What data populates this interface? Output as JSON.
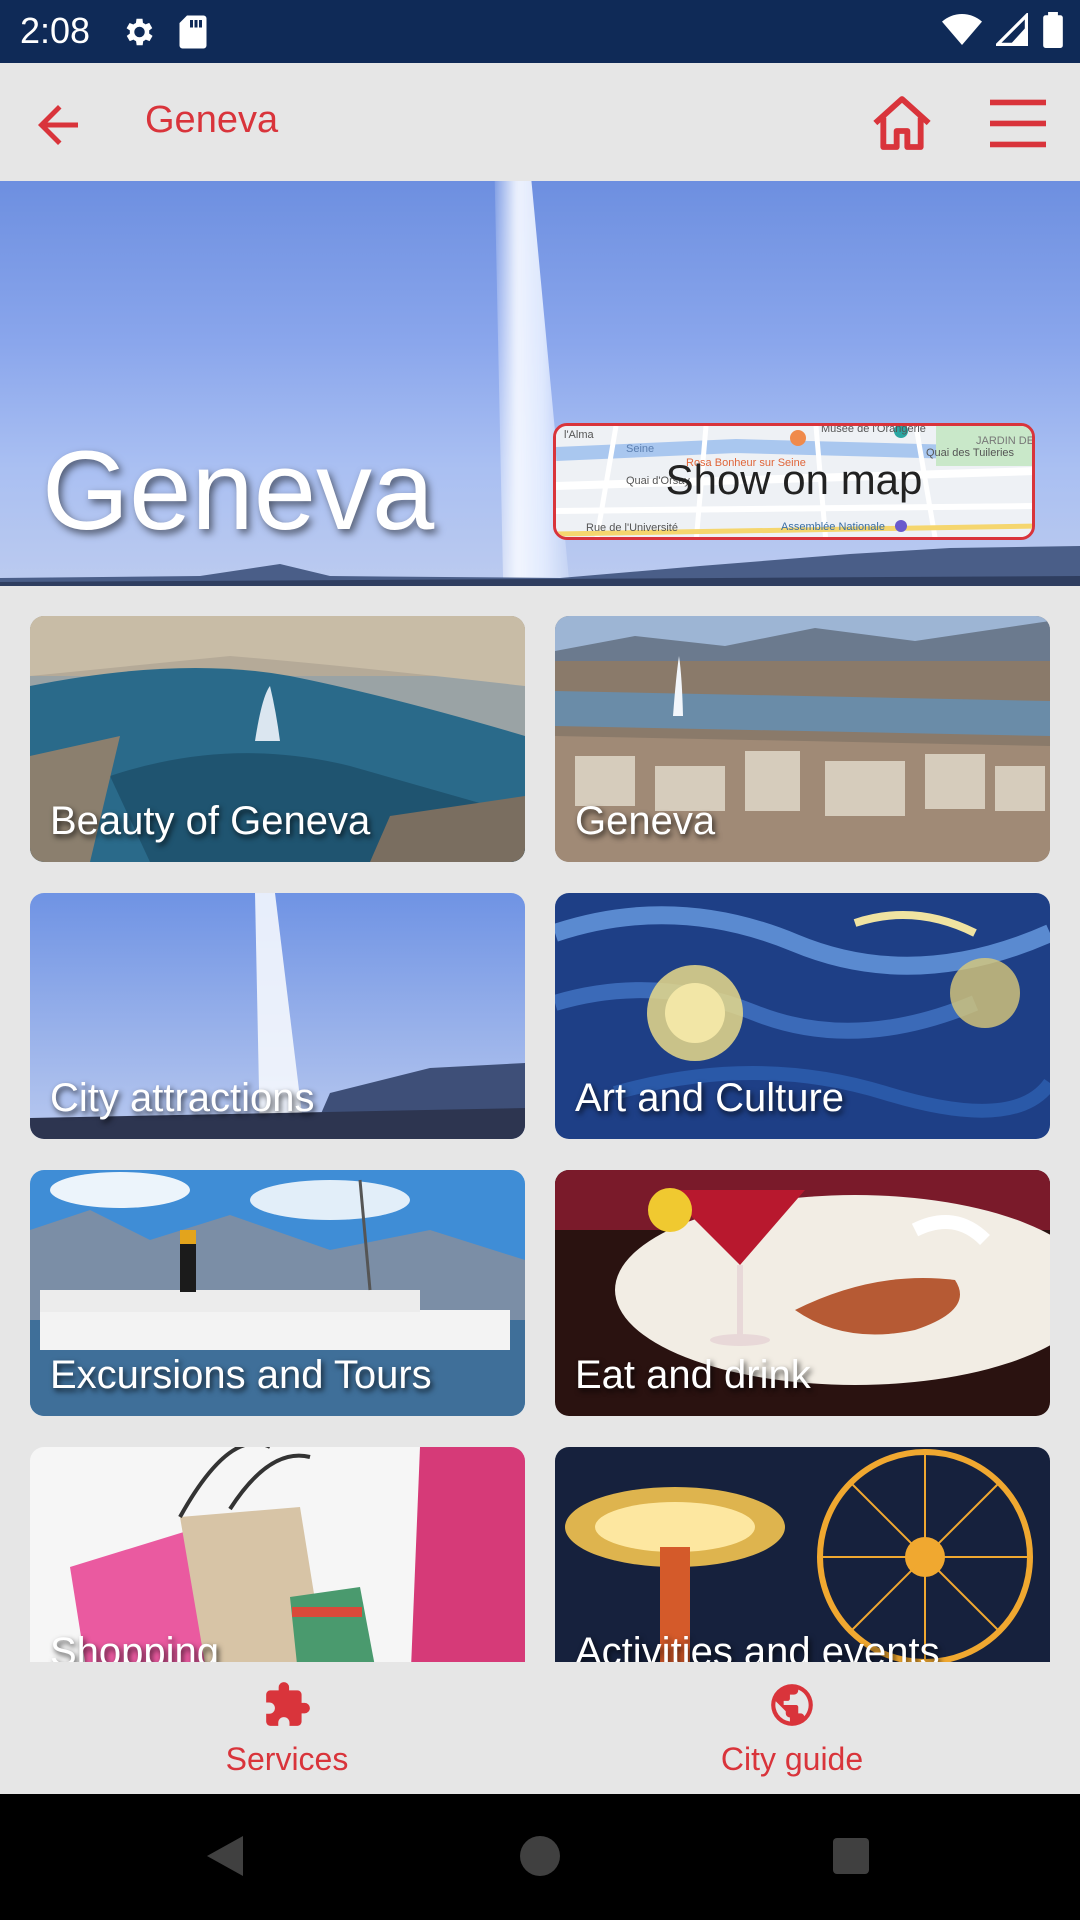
{
  "status_bar": {
    "time": "2:08",
    "left_icons": [
      "settings-icon",
      "sd-card-icon"
    ],
    "right_icons": [
      "wifi-icon",
      "cell-signal-icon",
      "battery-icon"
    ]
  },
  "app_bar": {
    "title": "Geneva",
    "back_icon": "arrow-left-icon",
    "home_icon": "home-icon",
    "menu_icon": "hamburger-menu-icon",
    "accent_color": "#d9343b"
  },
  "hero": {
    "title": "Geneva",
    "map_button_label": "Show on map",
    "map_streets": [
      "l'Alma",
      "Seine",
      "Musée de l'Orangerie",
      "Rosa Bonheur sur Seine",
      "Quai d'Orsay",
      "Quai des Tuileries",
      "Rue de l'Université",
      "Assemblée Nationale",
      "JARDIN DES TUILE"
    ]
  },
  "tiles": [
    {
      "label": "Beauty of Geneva"
    },
    {
      "label": "Geneva"
    },
    {
      "label": "City attractions"
    },
    {
      "label": "Art and Culture"
    },
    {
      "label": "Excursions and Tours"
    },
    {
      "label": "Eat and drink"
    },
    {
      "label": "Shopping"
    },
    {
      "label": "Activities and events"
    }
  ],
  "bottom_nav": {
    "items": [
      {
        "label": "Services",
        "icon": "puzzle-icon"
      },
      {
        "label": "City guide",
        "icon": "globe-icon"
      }
    ]
  },
  "system_nav": {
    "icons": [
      "back-triangle-icon",
      "home-circle-icon",
      "recents-square-icon"
    ]
  }
}
